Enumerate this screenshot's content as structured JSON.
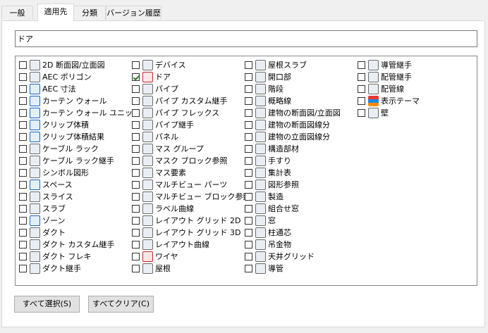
{
  "tabs": [
    "一般",
    "適用先",
    "分類",
    "バージョン履歴"
  ],
  "filter": {
    "value": "ドア"
  },
  "columns": [
    [
      {
        "label": "2D 断面図/立面図",
        "checked": false,
        "icon": "section-elevation-icon"
      },
      {
        "label": "AEC ポリゴン",
        "checked": false,
        "icon": "polygon-icon"
      },
      {
        "label": "AEC 寸法",
        "checked": false,
        "icon": "dimension-icon"
      },
      {
        "label": "カーテン ウォール",
        "checked": false,
        "icon": "curtain-wall-icon"
      },
      {
        "label": "カーテン ウォール ユニット",
        "checked": false,
        "icon": "curtain-wall-unit-icon"
      },
      {
        "label": "クリップ体積",
        "checked": false,
        "icon": "clip-volume-icon"
      },
      {
        "label": "クリップ体積結果",
        "checked": false,
        "icon": "clip-volume-result-icon"
      },
      {
        "label": "ケーブル ラック",
        "checked": false,
        "icon": "cable-tray-icon"
      },
      {
        "label": "ケーブル ラック継手",
        "checked": false,
        "icon": "cable-tray-fitting-icon"
      },
      {
        "label": "シンボル図形",
        "checked": false,
        "icon": "symbol-icon"
      },
      {
        "label": "スペース",
        "checked": false,
        "icon": "space-icon"
      },
      {
        "label": "スライス",
        "checked": false,
        "icon": "slice-icon"
      },
      {
        "label": "スラブ",
        "checked": false,
        "icon": "slab-icon"
      },
      {
        "label": "ゾーン",
        "checked": false,
        "icon": "zone-icon"
      },
      {
        "label": "ダクト",
        "checked": false,
        "icon": "duct-icon"
      },
      {
        "label": "ダクト カスタム継手",
        "checked": false,
        "icon": "duct-custom-fitting-icon"
      },
      {
        "label": "ダクト フレキ",
        "checked": false,
        "icon": "duct-flex-icon"
      },
      {
        "label": "ダクト継手",
        "checked": false,
        "icon": "duct-fitting-icon"
      }
    ],
    [
      {
        "label": "デバイス",
        "checked": false,
        "icon": "device-icon"
      },
      {
        "label": "ドア",
        "checked": true,
        "icon": "door-icon"
      },
      {
        "label": "パイプ",
        "checked": false,
        "icon": "pipe-icon"
      },
      {
        "label": "パイプ カスタム継手",
        "checked": false,
        "icon": "pipe-custom-fitting-icon"
      },
      {
        "label": "パイプ フレックス",
        "checked": false,
        "icon": "pipe-flex-icon"
      },
      {
        "label": "パイプ継手",
        "checked": false,
        "icon": "pipe-fitting-icon"
      },
      {
        "label": "パネル",
        "checked": false,
        "icon": "panel-icon"
      },
      {
        "label": "マス グループ",
        "checked": false,
        "icon": "mass-group-icon"
      },
      {
        "label": "マスク ブロック参照",
        "checked": false,
        "icon": "mask-block-icon"
      },
      {
        "label": "マス要素",
        "checked": false,
        "icon": "mass-element-icon"
      },
      {
        "label": "マルチビュー パーツ",
        "checked": false,
        "icon": "multiview-part-icon"
      },
      {
        "label": "マルチビュー ブロック参照",
        "checked": false,
        "icon": "multiview-block-icon"
      },
      {
        "label": "ラベル曲線",
        "checked": false,
        "icon": "label-curve-icon"
      },
      {
        "label": "レイアウト グリッド 2D",
        "checked": false,
        "icon": "layout-grid-2d-icon"
      },
      {
        "label": "レイアウト グリッド 3D",
        "checked": false,
        "icon": "layout-grid-3d-icon"
      },
      {
        "label": "レイアウト曲線",
        "checked": false,
        "icon": "layout-curve-icon"
      },
      {
        "label": "ワイヤ",
        "checked": false,
        "icon": "wire-icon"
      },
      {
        "label": "屋根",
        "checked": false,
        "icon": "roof-icon"
      }
    ],
    [
      {
        "label": "屋根スラブ",
        "checked": false,
        "icon": "roof-slab-icon"
      },
      {
        "label": "開口部",
        "checked": false,
        "icon": "opening-icon"
      },
      {
        "label": "階段",
        "checked": false,
        "icon": "stair-icon"
      },
      {
        "label": "概略線",
        "checked": false,
        "icon": "schematic-line-icon"
      },
      {
        "label": "建物の断面図/立面図",
        "checked": false,
        "icon": "building-section-icon"
      },
      {
        "label": "建物の断面図線分",
        "checked": false,
        "icon": "section-line-icon"
      },
      {
        "label": "建物の立面図線分",
        "checked": false,
        "icon": "elevation-line-icon"
      },
      {
        "label": "構造部材",
        "checked": false,
        "icon": "structural-member-icon"
      },
      {
        "label": "手すり",
        "checked": false,
        "icon": "railing-icon"
      },
      {
        "label": "集計表",
        "checked": false,
        "icon": "schedule-table-icon"
      },
      {
        "label": "図形参照",
        "checked": false,
        "icon": "shape-reference-icon"
      },
      {
        "label": "製造",
        "checked": false,
        "icon": "fabrication-icon"
      },
      {
        "label": "組合せ窓",
        "checked": false,
        "icon": "window-assembly-icon"
      },
      {
        "label": "窓",
        "checked": false,
        "icon": "window-icon"
      },
      {
        "label": "柱通芯",
        "checked": false,
        "icon": "column-grid-icon"
      },
      {
        "label": "吊金物",
        "checked": false,
        "icon": "hanger-icon"
      },
      {
        "label": "天井グリッド",
        "checked": false,
        "icon": "ceiling-grid-icon"
      },
      {
        "label": "導管",
        "checked": false,
        "icon": "conduit-icon"
      }
    ],
    [
      {
        "label": "導管継手",
        "checked": false,
        "icon": "conduit-fitting-icon"
      },
      {
        "label": "配管継手",
        "checked": false,
        "icon": "piping-fitting-icon"
      },
      {
        "label": "配管線",
        "checked": false,
        "icon": "piping-line-icon"
      },
      {
        "label": "表示テーマ",
        "checked": false,
        "icon": "display-theme-icon"
      },
      {
        "label": "壁",
        "checked": false,
        "icon": "wall-icon"
      }
    ]
  ],
  "buttons": {
    "select_all": "すべて選択(S)",
    "clear_all": "すべてクリア(C)"
  }
}
